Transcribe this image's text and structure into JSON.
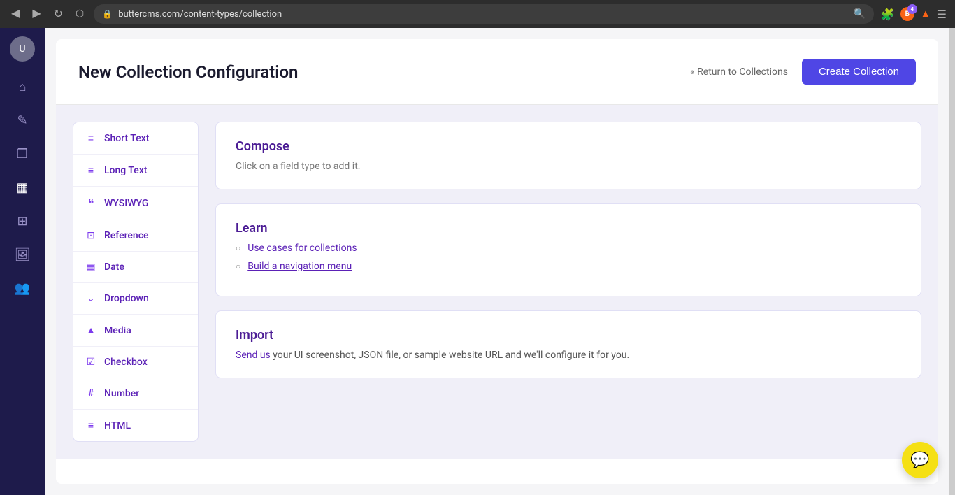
{
  "browser": {
    "url": "buttercms.com/content-types/collection",
    "back_icon": "◀",
    "forward_icon": "▶",
    "refresh_icon": "↻",
    "bookmark_icon": "⬡",
    "search_icon": "🔍",
    "lock_icon": "🔒"
  },
  "sidebar": {
    "avatar_initials": "U",
    "items": [
      {
        "name": "home",
        "icon": "⌂",
        "label": "Home"
      },
      {
        "name": "blog",
        "icon": "✎",
        "label": "Blog"
      },
      {
        "name": "pages",
        "icon": "❐",
        "label": "Pages"
      },
      {
        "name": "collections",
        "icon": "▦",
        "label": "Collections"
      },
      {
        "name": "components",
        "icon": "⊞",
        "label": "Components"
      },
      {
        "name": "media",
        "icon": "⬜",
        "label": "Media"
      },
      {
        "name": "users",
        "icon": "👥",
        "label": "Users"
      }
    ]
  },
  "header": {
    "title": "New Collection Configuration",
    "return_link": "« Return to Collections",
    "create_button": "Create Collection"
  },
  "field_types": {
    "items": [
      {
        "name": "short-text",
        "label": "Short Text",
        "icon": "≡"
      },
      {
        "name": "long-text",
        "label": "Long Text",
        "icon": "≡"
      },
      {
        "name": "wysiwyg",
        "label": "WYSIWYG",
        "icon": "❝"
      },
      {
        "name": "reference",
        "label": "Reference",
        "icon": "⊡"
      },
      {
        "name": "date",
        "label": "Date",
        "icon": "▦"
      },
      {
        "name": "dropdown",
        "label": "Dropdown",
        "icon": "⌄"
      },
      {
        "name": "media",
        "label": "Media",
        "icon": "▲"
      },
      {
        "name": "checkbox",
        "label": "Checkbox",
        "icon": "☑"
      },
      {
        "name": "number",
        "label": "Number",
        "icon": "#"
      },
      {
        "name": "html",
        "label": "HTML",
        "icon": "≡"
      }
    ]
  },
  "compose": {
    "title": "Compose",
    "subtitle": "Click on a field type to add it."
  },
  "learn": {
    "title": "Learn",
    "links": [
      {
        "name": "use-cases",
        "text": "Use cases for collections",
        "href": "#"
      },
      {
        "name": "build-nav",
        "text": "Build a navigation menu",
        "href": "#"
      }
    ]
  },
  "import": {
    "title": "Import",
    "link_text": "Send us",
    "body_text": " your UI screenshot, JSON file, or sample website URL and we'll configure it for you."
  },
  "chat_button": {
    "icon": "💬"
  }
}
